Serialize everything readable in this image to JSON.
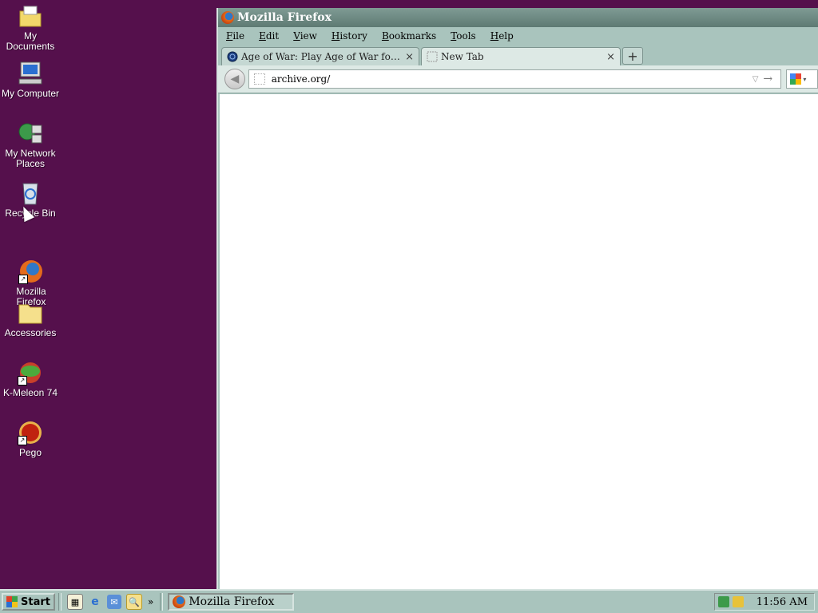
{
  "desktop": {
    "icons": [
      {
        "label": "My Documents"
      },
      {
        "label": "My Computer"
      },
      {
        "label": "My Network Places"
      },
      {
        "label": "Recycle Bin"
      },
      {
        "label": "Mozilla Firefox"
      },
      {
        "label": "Accessories"
      },
      {
        "label": "K-Meleon 74"
      },
      {
        "label": "Pego"
      }
    ]
  },
  "window": {
    "title": "Mozilla Firefox",
    "menu": [
      "File",
      "Edit",
      "View",
      "History",
      "Bookmarks",
      "Tools",
      "Help"
    ],
    "tabs": [
      {
        "title": "Age of War: Play Age of War for free",
        "close": "×"
      },
      {
        "title": "New Tab",
        "close": "×"
      }
    ],
    "new_tab_label": "+",
    "url": "archive.org/"
  },
  "taskbar": {
    "start_label": "Start",
    "chevron": "»",
    "task_button": "Mozilla Firefox",
    "clock": "11:56 AM"
  },
  "colors": {
    "desktop": "#55104c",
    "chrome": "#a9c4bd",
    "titlebar": "#6b8780"
  }
}
